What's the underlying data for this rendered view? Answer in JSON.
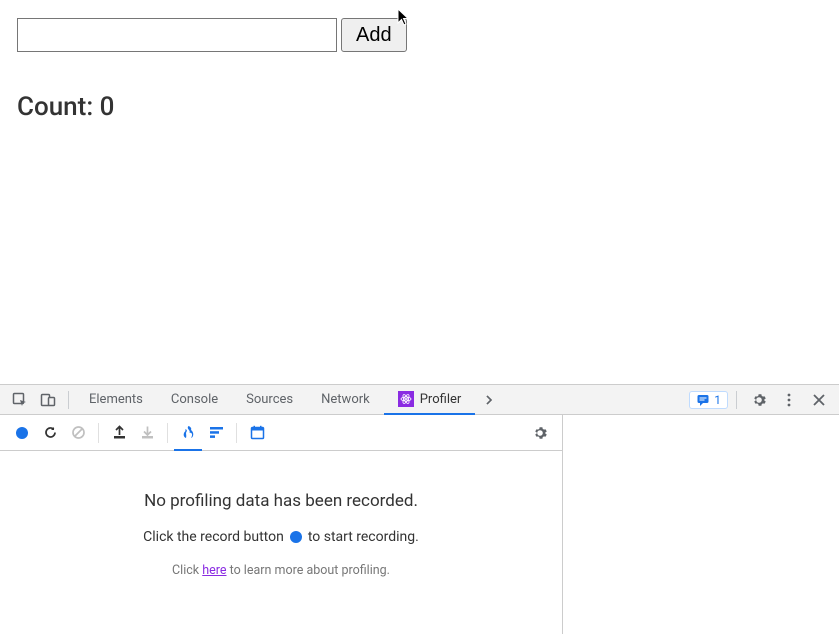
{
  "app": {
    "input_value": "",
    "add_label": "Add",
    "count_prefix": "Count: ",
    "count_value": "0"
  },
  "devtools": {
    "tabs": {
      "elements": "Elements",
      "console": "Console",
      "sources": "Sources",
      "network": "Network",
      "profiler": "Profiler"
    },
    "issues_count": "1"
  },
  "profiler": {
    "empty_title": "No profiling data has been recorded.",
    "empty_sub_before": "Click the record button",
    "empty_sub_after": "to start recording.",
    "learn_before": "Click",
    "learn_link": "here",
    "learn_after": "to learn more about profiling."
  }
}
